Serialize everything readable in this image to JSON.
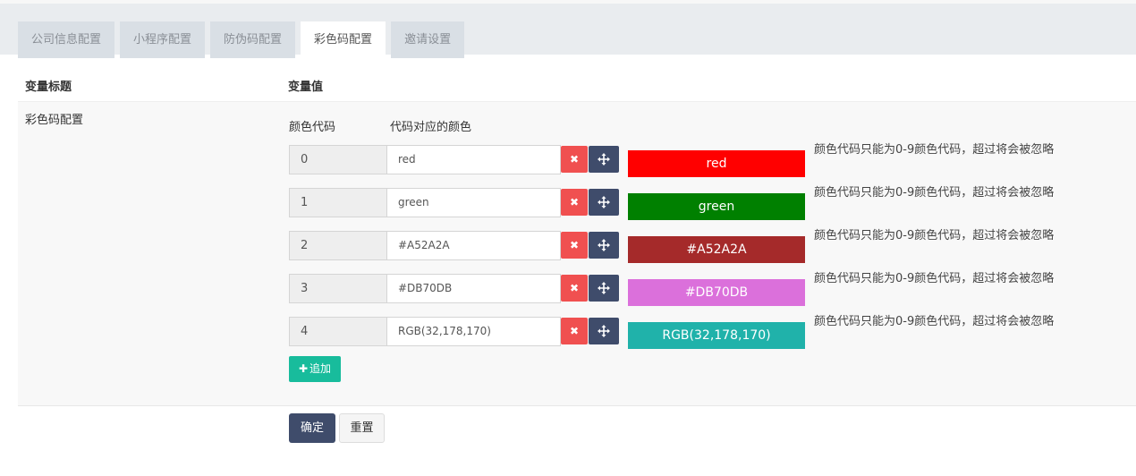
{
  "tabs": [
    {
      "label": "公司信息配置"
    },
    {
      "label": "小程序配置"
    },
    {
      "label": "防伪码配置"
    },
    {
      "label": "彩色码配置"
    },
    {
      "label": "邀请设置"
    }
  ],
  "active_tab": 3,
  "table": {
    "col_title": "变量标题",
    "col_value": "变量值"
  },
  "row": {
    "title": "彩色码配置",
    "code_header": "颜色代码",
    "color_header": "代码对应的颜色",
    "note": "颜色代码只能为0-9颜色代码，超过将会被忽略",
    "items": [
      {
        "code": "0",
        "color": "red",
        "swatch_label": "red",
        "swatch_color": "#ff0000"
      },
      {
        "code": "1",
        "color": "green",
        "swatch_label": "green",
        "swatch_color": "#008000"
      },
      {
        "code": "2",
        "color": "#A52A2A",
        "swatch_label": "#A52A2A",
        "swatch_color": "#A52A2A"
      },
      {
        "code": "3",
        "color": "#DB70DB",
        "swatch_label": "#DB70DB",
        "swatch_color": "#DB70DB"
      },
      {
        "code": "4",
        "color": "RGB(32,178,170)",
        "swatch_label": "RGB(32,178,170)",
        "swatch_color": "#20B2AA"
      }
    ]
  },
  "buttons": {
    "delete_glyph": "✖",
    "move_icon": "move-icon",
    "add_label": "追加",
    "add_plus": "✚",
    "confirm_label": "确定",
    "reset_label": "重置"
  }
}
